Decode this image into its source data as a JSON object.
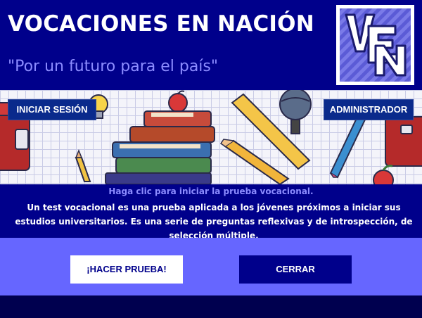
{
  "header": {
    "title": "VOCACIONES EN NACIÓN",
    "tagline": "\"Por un futuro para el país\"",
    "logo_text": "VEN"
  },
  "nav": {
    "login_label": "INICIAR SESIÓN",
    "admin_label": "ADMINISTRADOR"
  },
  "info": {
    "heading": "Haga clic para iniciar la prueba vocacional.",
    "body": "Un test vocacional es una prueba aplicada a los jóvenes próximos a iniciar sus estudios universitarios. Es una serie de preguntas reflexivas y de introspección, de selección múltiple."
  },
  "actions": {
    "take_test_label": "¡HACER PRUEBA!",
    "close_label": "CERRAR"
  },
  "colors": {
    "header_bg": "#00008b",
    "accent": "#6666ff",
    "tagline": "#8c8cff",
    "page_bg": "#00004f"
  }
}
